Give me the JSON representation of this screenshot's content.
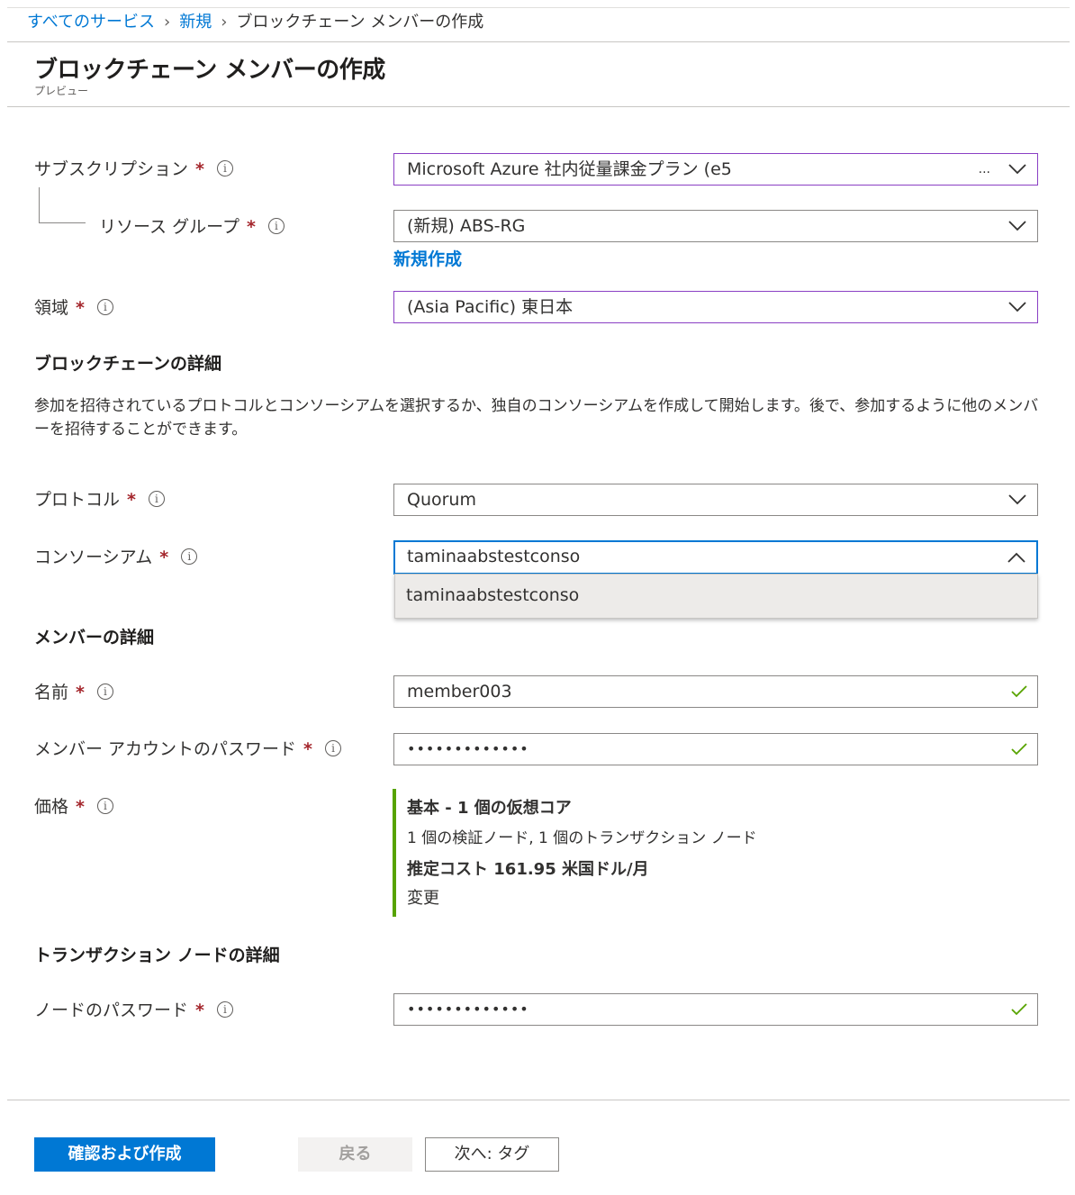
{
  "breadcrumb": {
    "all_services": "すべてのサービス",
    "new": "新規",
    "current": "ブロックチェーン メンバーの作成",
    "separator": "›"
  },
  "header": {
    "title": "ブロックチェーン メンバーの作成",
    "subtitle": "プレビュー"
  },
  "project": {
    "subscription_label": "サブスクリプション",
    "subscription_value": "Microsoft Azure 社内従量課金プラン (e5",
    "subscription_ellipsis": "...",
    "resource_group_label": "リソース グループ",
    "resource_group_value": "(新規) ABS-RG",
    "create_new_link": "新規作成",
    "region_label": "領域",
    "region_value": "(Asia Pacific) 東日本"
  },
  "blockchain": {
    "section_title": "ブロックチェーンの詳細",
    "description": "参加を招待されているプロトコルとコンソーシアムを選択するか、独自のコンソーシアムを作成して開始します。後で、参加するように他のメンバーを招待することができます。",
    "protocol_label": "プロトコル",
    "protocol_value": "Quorum",
    "consortium_label": "コンソーシアム",
    "consortium_value": "taminaabstestconso",
    "consortium_options": [
      "taminaabstestconso"
    ]
  },
  "member": {
    "section_title": "メンバーの詳細",
    "name_label": "名前",
    "name_value": "member003",
    "password_label": "メンバー アカウントのパスワード",
    "password_value": "•••••••••••••",
    "pricing_label": "価格",
    "pricing_tier": "基本 - 1 個の仮想コア",
    "pricing_nodes": "1 個の検証ノード, 1 個のトランザクション ノード",
    "pricing_cost": "推定コスト 161.95 米国ドル/月",
    "pricing_change_link": "変更"
  },
  "transaction_node": {
    "section_title": "トランザクション ノードの詳細",
    "password_label": "ノードのパスワード",
    "password_value": "•••••••••••••"
  },
  "common": {
    "required_mark": "*",
    "info_glyph": "i"
  },
  "footer": {
    "review_create": "確認および作成",
    "back": "戻る",
    "next": "次へ: タグ"
  },
  "colors": {
    "accent": "#0078d4",
    "required": "#a4262c",
    "valid": "#57a300",
    "changed_border": "#8a3fc4"
  },
  "icons": [
    "info-icon",
    "chevron-down-icon",
    "chevron-up-icon",
    "checkmark-icon"
  ]
}
